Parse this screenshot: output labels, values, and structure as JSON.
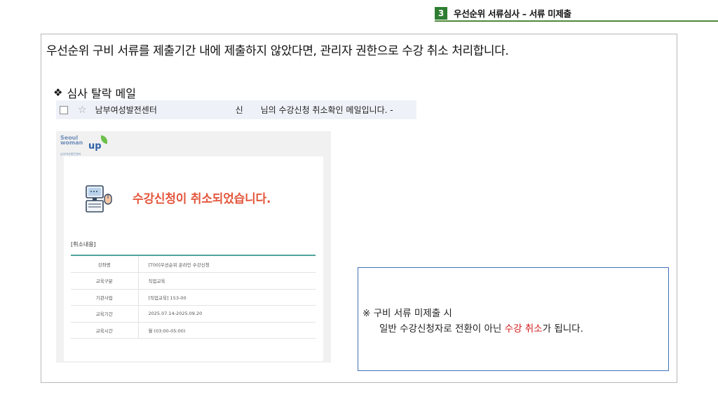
{
  "header": {
    "step_number": "3",
    "title": "우선순위 서류심사 – 서류 미제출"
  },
  "intro_text": "우선순위 구비 서류를 제출기간 내에 제출하지 않았다면, 관리자 권한으로 수강 취소 처리합니다.",
  "mail_section": {
    "bullet": "❖",
    "heading": "심사 탈락 메일",
    "inbox_row": {
      "sender": "남부여성발전센터",
      "name_fragment": "신",
      "subject": "님의 수강신청 취소확인 메일입니다. -"
    }
  },
  "email": {
    "logo": {
      "line1": "Seoul",
      "line2": "woman",
      "up": "up",
      "sub": "남부여성발전센터"
    },
    "message": "수강신청이 취소되었습니다.",
    "section_label": "[취소내용]",
    "rows": [
      {
        "key": "강좌명",
        "value": "[T00]우선순위 온라인 수강신청"
      },
      {
        "key": "교육구분",
        "value": "직업교육"
      },
      {
        "key": "기관사업",
        "value": "[직업교육] 153-00"
      },
      {
        "key": "교육기간",
        "value": "2025.07.14-2025.09.20"
      },
      {
        "key": "교육시간",
        "value": "월 (03:00-05:00)"
      }
    ]
  },
  "notice": {
    "line1": "※ 구비 서류 미제출 시",
    "line2_prefix": "일반 수강신청자로 전환이 아닌 ",
    "line2_highlight": "수강 취소",
    "line2_suffix": "가 됩니다.",
    "highlight_color": "#d11a1a"
  },
  "colors": {
    "accent_green": "#2e7d32",
    "message_red": "#e4573d",
    "notice_border": "#3f74b8"
  }
}
